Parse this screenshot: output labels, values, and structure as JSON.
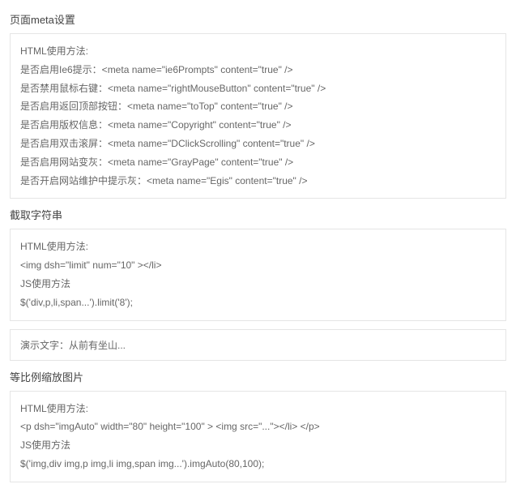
{
  "sections": [
    {
      "title": "页面meta设置",
      "panel": {
        "lines": [
          "HTML使用方法:",
          "是否启用Ie6提示：<meta name=\"ie6Prompts\" content=\"true\" />",
          "是否禁用鼠标右键：<meta name=\"rightMouseButton\" content=\"true\" />",
          "是否启用返回顶部按钮：<meta name=\"toTop\" content=\"true\" />",
          "是否启用版权信息：<meta name=\"Copyright\" content=\"true\" />",
          "是否启用双击滚屏：<meta name=\"DClickScrolling\" content=\"true\" />",
          "是否启用网站变灰：<meta name=\"GrayPage\" content=\"true\" />",
          "是否开启网站维护中提示灰：<meta name=\"Egis\" content=\"true\" />"
        ]
      }
    },
    {
      "title": "截取字符串",
      "panel": {
        "lines": [
          "HTML使用方法:",
          "<img dsh=\"limit\" num=\"10\" ></li>",
          "JS使用方法",
          "$('div,p,li,span...').limit('8');"
        ]
      },
      "demo": "演示文字：从前有坐山..."
    },
    {
      "title": "等比例缩放图片",
      "panel": {
        "lines": [
          "HTML使用方法:",
          "<p dsh=\"imgAuto\" width=\"80\" height=\"100\" > <img src=\"...\"></li> </p>",
          "JS使用方法",
          "$('img,div img,p img,li img,span img...').imgAuto(80,100);"
        ]
      }
    }
  ]
}
